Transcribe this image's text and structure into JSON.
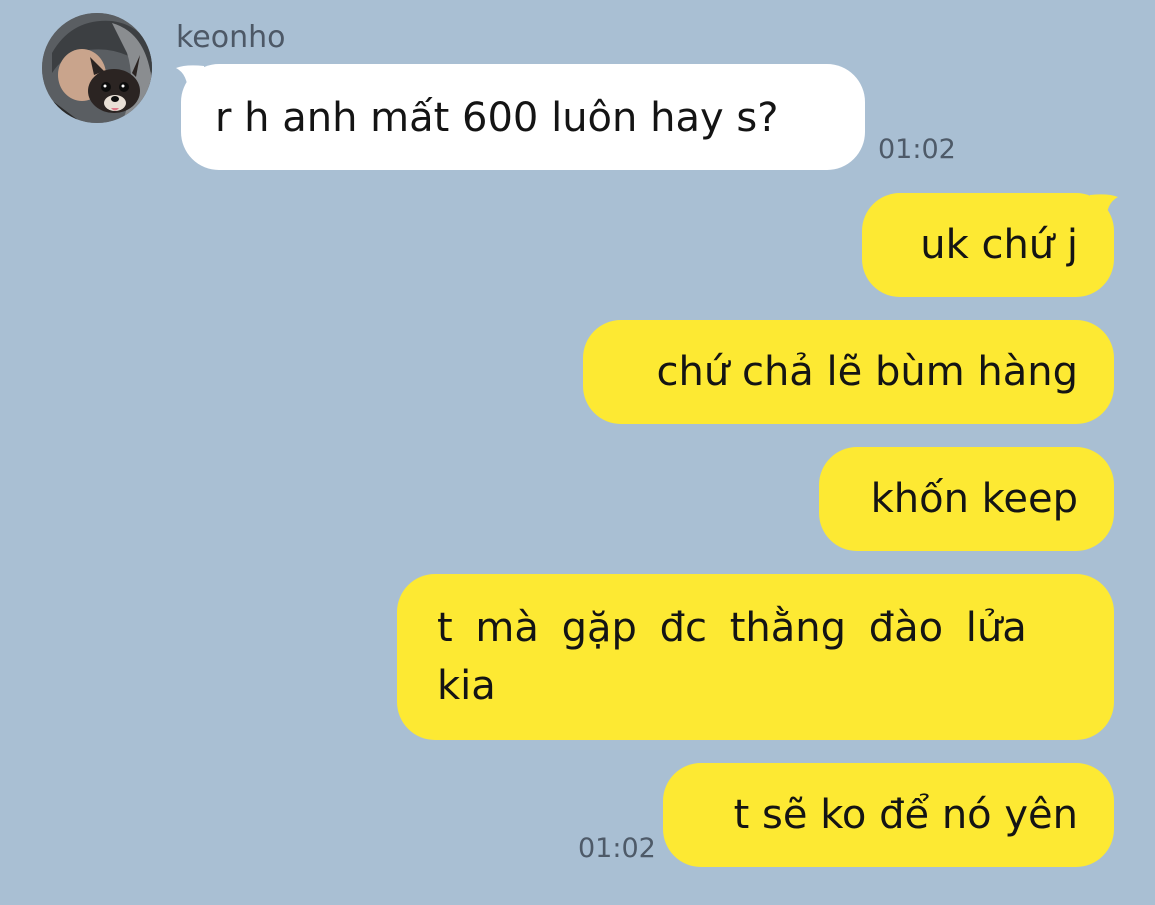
{
  "contact": {
    "name": "keonho",
    "avatar_icon": "profile-photo-man-with-dog"
  },
  "messages": [
    {
      "direction": "incoming",
      "text": "r h anh mất 600 luôn hay s?",
      "time": "01:02"
    },
    {
      "direction": "outgoing",
      "text": "uk chứ j"
    },
    {
      "direction": "outgoing",
      "text": "chứ chả lẽ bùm hàng"
    },
    {
      "direction": "outgoing",
      "text": "khốn keep"
    },
    {
      "direction": "outgoing",
      "text": "t mà gặp đc thằng đào lửa\nkia"
    },
    {
      "direction": "outgoing",
      "text": "t sẽ ko để nó yên",
      "time": "01:02"
    }
  ],
  "colors": {
    "background": "#a9bfd3",
    "incoming_bubble": "#ffffff",
    "outgoing_bubble": "#fde933",
    "text": "#141414",
    "meta_text": "#4e5a68"
  }
}
